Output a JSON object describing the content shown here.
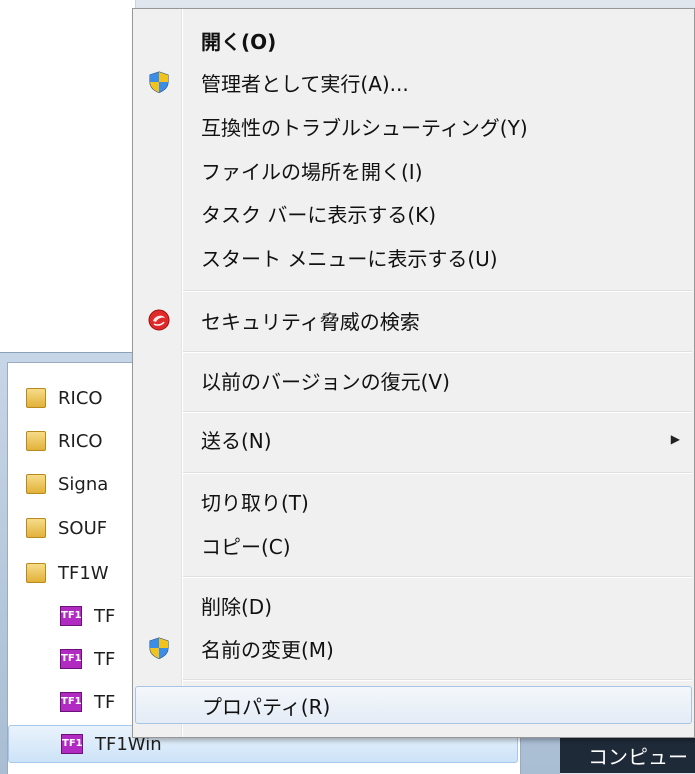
{
  "context_menu": {
    "items": [
      {
        "label": "開く(O)"
      },
      {
        "label": "管理者として実行(A)..."
      },
      {
        "label": "互換性のトラブルシューティング(Y)"
      },
      {
        "label": "ファイルの場所を開く(I)"
      },
      {
        "label": "タスク バーに表示する(K)"
      },
      {
        "label": "スタート メニューに表示する(U)"
      },
      {
        "label": "セキュリティ脅威の検索"
      },
      {
        "label": "以前のバージョンの復元(V)"
      },
      {
        "label": "送る(N)"
      },
      {
        "label": "切り取り(T)"
      },
      {
        "label": "コピー(C)"
      },
      {
        "label": "削除(D)"
      },
      {
        "label": "名前の変更(M)"
      },
      {
        "label": "プロパティ(R)"
      }
    ],
    "icons": {
      "run_as_admin": "uac-shield-icon",
      "security_scan": "security-scan-icon",
      "rename": "uac-shield-icon",
      "send_to": "submenu-arrow-icon"
    }
  },
  "program_list": {
    "items": [
      {
        "label": "RICO",
        "icon": "folder-icon"
      },
      {
        "label": "RICO",
        "icon": "folder-icon"
      },
      {
        "label": "Signa",
        "icon": "folder-icon"
      },
      {
        "label": "SOUF",
        "icon": "folder-icon"
      },
      {
        "label": "TF1W",
        "icon": "folder-icon"
      },
      {
        "label": "TF",
        "icon": "tf1-app-icon"
      },
      {
        "label": "TF",
        "icon": "tf1-app-icon"
      },
      {
        "label": "TF",
        "icon": "tf1-app-icon"
      },
      {
        "label": "TF1Win",
        "icon": "tf1-app-icon"
      }
    ],
    "icon_text": "TF1"
  },
  "right_pane": {
    "computer_label": "コンピュー"
  }
}
